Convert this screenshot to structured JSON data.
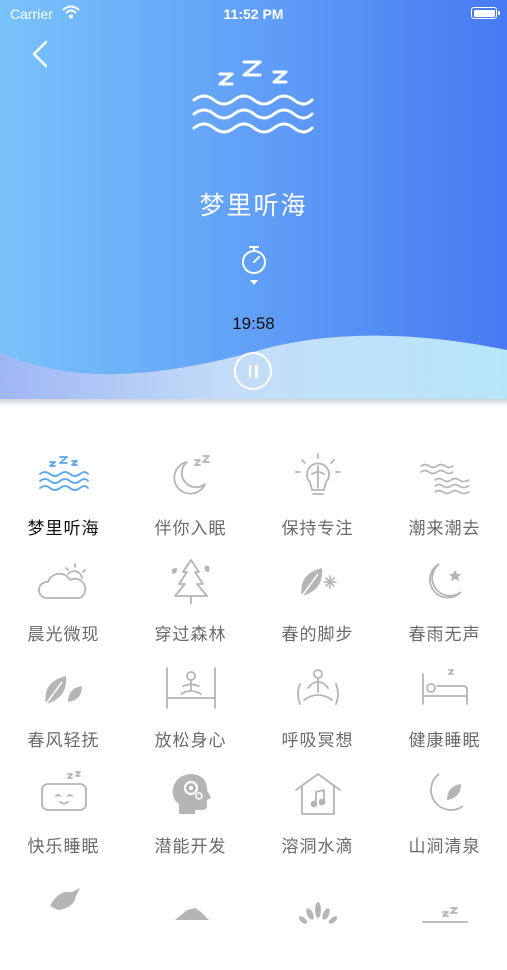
{
  "status_bar": {
    "carrier": "Carrier",
    "time": "11:52 PM"
  },
  "player": {
    "title": "梦里听海",
    "remaining": "19:58",
    "hero_icon": "sleep-waves-icon",
    "colors": {
      "gradient_start": "#79c3fb",
      "gradient_end": "#4779f2",
      "active_icon": "#5aa6f0"
    }
  },
  "sounds": [
    {
      "label": "梦里听海",
      "icon": "sleep-waves-icon",
      "active": true
    },
    {
      "label": "伴你入眠",
      "icon": "moon-zzz-icon",
      "active": false
    },
    {
      "label": "保持专注",
      "icon": "lightbulb-brain-icon",
      "active": false
    },
    {
      "label": "潮来潮去",
      "icon": "tide-waves-icon",
      "active": false
    },
    {
      "label": "晨光微现",
      "icon": "sunrise-cloud-icon",
      "active": false
    },
    {
      "label": "穿过森林",
      "icon": "pine-tree-icon",
      "active": false
    },
    {
      "label": "春的脚步",
      "icon": "leaf-flower-icon",
      "active": false
    },
    {
      "label": "春雨无声",
      "icon": "moon-star-icon",
      "active": false
    },
    {
      "label": "春风轻抚",
      "icon": "leaves-icon",
      "active": false
    },
    {
      "label": "放松身心",
      "icon": "meditation-frame-icon",
      "active": false
    },
    {
      "label": "呼吸冥想",
      "icon": "breathing-meditation-icon",
      "active": false
    },
    {
      "label": "健康睡眠",
      "icon": "bed-icon",
      "active": false
    },
    {
      "label": "快乐睡眠",
      "icon": "pillow-zzz-icon",
      "active": false
    },
    {
      "label": "潜能开发",
      "icon": "head-gears-icon",
      "active": false
    },
    {
      "label": "溶洞水滴",
      "icon": "house-music-icon",
      "active": false
    },
    {
      "label": "山涧清泉",
      "icon": "moon-leaf-icon",
      "active": false
    },
    {
      "label": "",
      "icon": "bird-icon",
      "active": false
    },
    {
      "label": "",
      "icon": "animal-icon",
      "active": false
    },
    {
      "label": "",
      "icon": "fountain-icon",
      "active": false
    },
    {
      "label": "",
      "icon": "bed-zzz-icon",
      "active": false
    }
  ]
}
